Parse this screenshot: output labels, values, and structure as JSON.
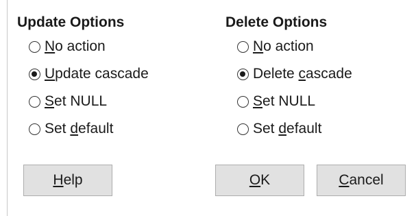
{
  "update_options": {
    "title": "Update Options",
    "options": [
      {
        "pre": "",
        "key": "N",
        "post": "o action",
        "checked": false
      },
      {
        "pre": "",
        "key": "U",
        "post": "pdate cascade",
        "checked": true
      },
      {
        "pre": "",
        "key": "S",
        "post": "et NULL",
        "checked": false
      },
      {
        "pre": "Set ",
        "key": "d",
        "post": "efault",
        "checked": false
      }
    ]
  },
  "delete_options": {
    "title": "Delete Options",
    "options": [
      {
        "pre": "",
        "key": "N",
        "post": "o action",
        "checked": false
      },
      {
        "pre": "Delete ",
        "key": "c",
        "post": "ascade",
        "checked": true
      },
      {
        "pre": "",
        "key": "S",
        "post": "et NULL",
        "checked": false
      },
      {
        "pre": "Set ",
        "key": "d",
        "post": "efault",
        "checked": false
      }
    ]
  },
  "buttons": {
    "help": {
      "pre": "",
      "key": "H",
      "post": "elp"
    },
    "ok": {
      "pre": "",
      "key": "O",
      "post": "K"
    },
    "cancel": {
      "pre": "",
      "key": "C",
      "post": "ancel"
    }
  }
}
